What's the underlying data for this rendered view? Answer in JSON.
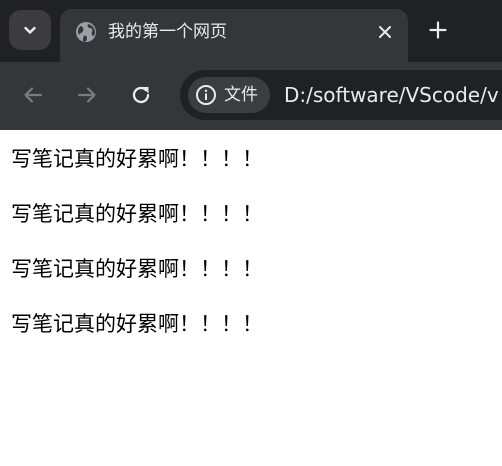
{
  "browser": {
    "tab_search_icon": "chevron-down-icon",
    "tab": {
      "title": "我的第一个网页",
      "favicon": "globe-icon",
      "close_icon": "close-icon"
    },
    "new_tab_icon": "plus-icon",
    "toolbar": {
      "back_icon": "arrow-left-icon",
      "forward_icon": "arrow-right-icon",
      "reload_icon": "reload-icon",
      "site_info_icon": "info-icon",
      "site_info_label": "文件",
      "url": "D:/software/VScode/v"
    }
  },
  "page": {
    "paragraphs": [
      "写笔记真的好累啊！！！！",
      "写笔记真的好累啊！！！！",
      "写笔记真的好累啊！！！！",
      "写笔记真的好累啊！！！！"
    ]
  },
  "colors": {
    "tabstrip_bg": "#202124",
    "active_tab_bg": "#35363a",
    "toolbar_bg": "#35363a",
    "omnibox_bg": "#202124",
    "chip_bg": "#3c3d40",
    "text_light": "#e8eaed",
    "icon_disabled": "#7a7c80",
    "page_bg": "#ffffff",
    "page_text": "#000000"
  }
}
